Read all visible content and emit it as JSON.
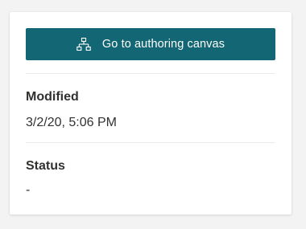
{
  "card": {
    "action_button": {
      "label": "Go to authoring canvas",
      "icon": "hierarchy-icon",
      "color": "#136673"
    },
    "fields": [
      {
        "label": "Modified",
        "value": "3/2/20, 5:06 PM"
      },
      {
        "label": "Status",
        "value": "-"
      }
    ]
  }
}
